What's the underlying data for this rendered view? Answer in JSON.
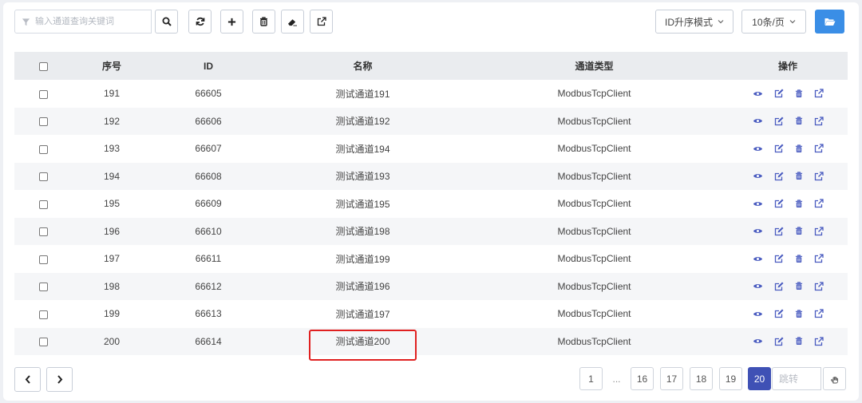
{
  "search": {
    "placeholder": "输入通道查询关键词"
  },
  "toolbar": {
    "sort_mode": "ID升序模式",
    "page_size": "10条/页"
  },
  "table": {
    "headers": [
      "序号",
      "ID",
      "名称",
      "通道类型",
      "操作"
    ],
    "rows": [
      {
        "seq": "191",
        "id": "66605",
        "name": "测试通道191",
        "type": "ModbusTcpClient"
      },
      {
        "seq": "192",
        "id": "66606",
        "name": "测试通道192",
        "type": "ModbusTcpClient"
      },
      {
        "seq": "193",
        "id": "66607",
        "name": "测试通道194",
        "type": "ModbusTcpClient"
      },
      {
        "seq": "194",
        "id": "66608",
        "name": "测试通道193",
        "type": "ModbusTcpClient"
      },
      {
        "seq": "195",
        "id": "66609",
        "name": "测试通道195",
        "type": "ModbusTcpClient"
      },
      {
        "seq": "196",
        "id": "66610",
        "name": "测试通道198",
        "type": "ModbusTcpClient"
      },
      {
        "seq": "197",
        "id": "66611",
        "name": "测试通道199",
        "type": "ModbusTcpClient"
      },
      {
        "seq": "198",
        "id": "66612",
        "name": "测试通道196",
        "type": "ModbusTcpClient"
      },
      {
        "seq": "199",
        "id": "66613",
        "name": "测试通道197",
        "type": "ModbusTcpClient"
      },
      {
        "seq": "200",
        "id": "66614",
        "name": "测试通道200",
        "type": "ModbusTcpClient"
      }
    ]
  },
  "pagination": {
    "pages": [
      "1",
      "...",
      "16",
      "17",
      "18",
      "19",
      "20"
    ],
    "current": "20",
    "jump_placeholder": "跳转"
  },
  "colors": {
    "primary": "#3a8ee6",
    "active_page": "#3f51b5",
    "icon": "#4a5cc0",
    "highlight": "#e02020"
  }
}
